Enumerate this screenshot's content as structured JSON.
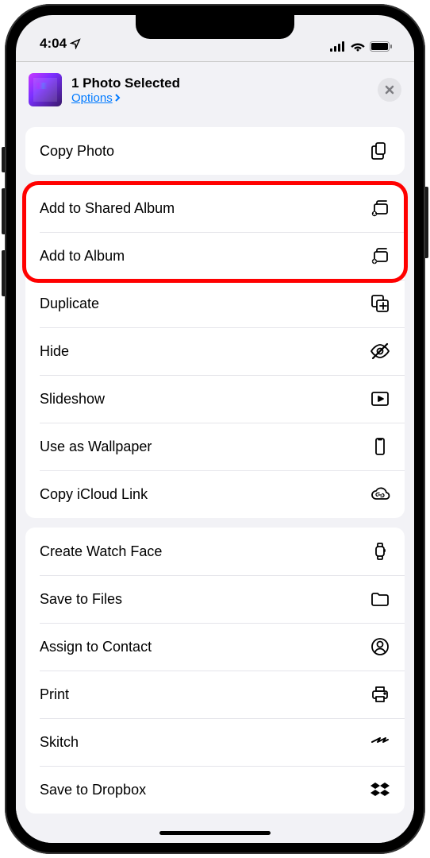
{
  "status": {
    "time": "4:04",
    "location_icon": "location-icon"
  },
  "header": {
    "title": "1 Photo Selected",
    "options_label": "Options"
  },
  "groups": [
    {
      "highlighted": false,
      "rowsHighlighted": [],
      "items": [
        {
          "label": "Copy Photo",
          "icon": "copy-doc-icon"
        }
      ]
    },
    {
      "highlighted": false,
      "rowsHighlighted": [
        0,
        1
      ],
      "items": [
        {
          "label": "Add to Shared Album",
          "icon": "shared-album-icon"
        },
        {
          "label": "Add to Album",
          "icon": "add-album-icon"
        },
        {
          "label": "Duplicate",
          "icon": "duplicate-icon"
        },
        {
          "label": "Hide",
          "icon": "hide-icon"
        },
        {
          "label": "Slideshow",
          "icon": "slideshow-icon"
        },
        {
          "label": "Use as Wallpaper",
          "icon": "wallpaper-icon"
        },
        {
          "label": "Copy iCloud Link",
          "icon": "cloud-link-icon"
        }
      ]
    },
    {
      "highlighted": false,
      "rowsHighlighted": [],
      "items": [
        {
          "label": "Create Watch Face",
          "icon": "watch-icon"
        },
        {
          "label": "Save to Files",
          "icon": "folder-icon"
        },
        {
          "label": "Assign to Contact",
          "icon": "contact-icon"
        },
        {
          "label": "Print",
          "icon": "print-icon"
        },
        {
          "label": "Skitch",
          "icon": "skitch-icon"
        },
        {
          "label": "Save to Dropbox",
          "icon": "dropbox-icon"
        }
      ]
    }
  ]
}
